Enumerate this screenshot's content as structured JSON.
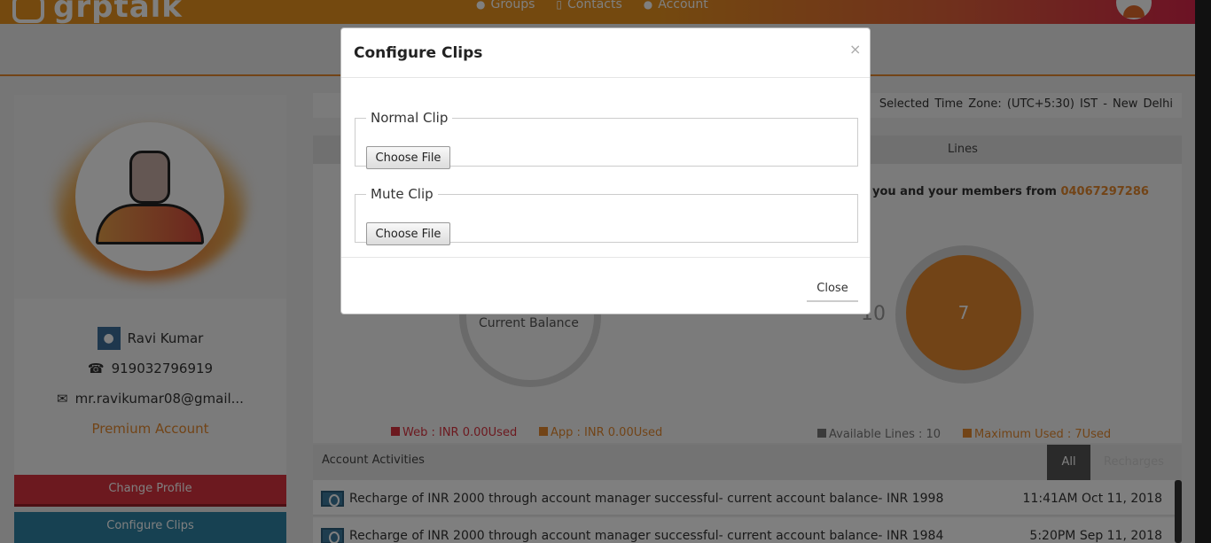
{
  "app": {
    "logo_text": "grptalk",
    "nav": [
      {
        "label": "Groups",
        "icon": "users-icon"
      },
      {
        "label": "Contacts",
        "icon": "address-book-icon"
      },
      {
        "label": "Account",
        "icon": "user-icon"
      }
    ]
  },
  "profile": {
    "name": "Ravi Kumar",
    "phone": "919032796919",
    "email": "mr.ravikumar08@gmail...",
    "plan": "Premium Account",
    "change_profile_label": "Change Profile",
    "configure_clips_label": "Configure Clips"
  },
  "timezone": {
    "label": "Selected Time Zone:",
    "value": "(UTC+5:30) IST - New Delhi"
  },
  "lines_panel": {
    "title": "Lines",
    "calls_text": "you and your members from",
    "calls_number": "04067297286",
    "balance_label": "Current Balance",
    "available_number": "10",
    "used_count": "7",
    "legend": {
      "web": "Web : INR 0.00Used",
      "app": "App : INR 0.00Used",
      "available": "Available Lines : 10",
      "maximum": "Maximum Used : 7Used"
    }
  },
  "activities": {
    "title": "Account Activities",
    "tabs": [
      "All",
      "Recharges"
    ],
    "rows": [
      {
        "text": "Recharge of INR 2000 through account manager successful- current account balance- INR 1998",
        "time": "11:41AM Oct 11, 2018"
      },
      {
        "text": "Recharge of INR 2000 through account manager successful- current account balance- INR 1984",
        "time": "5:20PM Sep 11, 2018"
      }
    ]
  },
  "modal": {
    "title": "Configure Clips",
    "close_x": "×",
    "normal_clip_legend": "Normal Clip",
    "mute_clip_legend": "Mute Clip",
    "choose_file_label": "Choose File",
    "close_label": "Close"
  },
  "colors": {
    "accent_orange": "#e4892f",
    "brand_red": "#d9333f",
    "brand_blue": "#2e83a5"
  }
}
